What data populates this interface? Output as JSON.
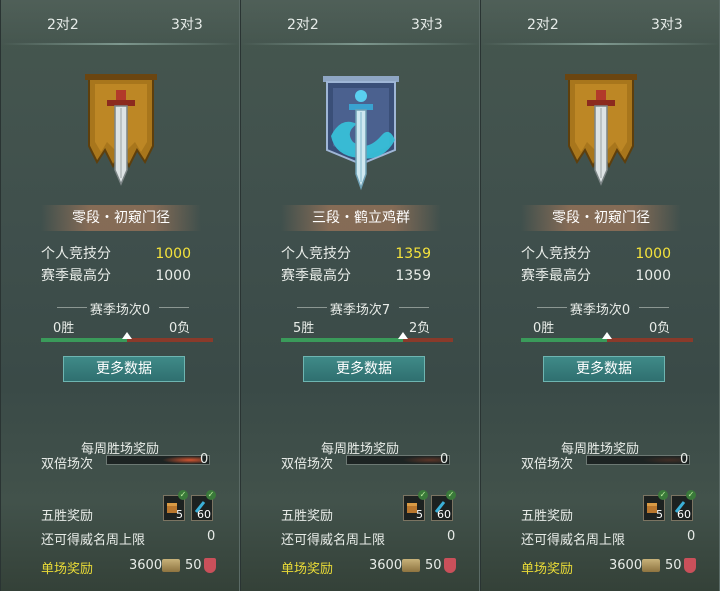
{
  "panels": [
    {
      "tabs": {
        "left": "2对2",
        "right": "3对3"
      },
      "emblem": "bronze-sword-banner-icon",
      "rank": "零段・初窥门径",
      "score": {
        "label": "个人竞技分",
        "value": "1000"
      },
      "high": {
        "label": "赛季最高分",
        "value": "1000"
      },
      "season": {
        "title": "赛季场次0",
        "wins": "0胜",
        "losses": "0负",
        "progress": 0.5
      },
      "more_button": "更多数据",
      "weekly": {
        "title": "每周胜场奖励",
        "double_label": "双倍场次",
        "double_value": "0"
      },
      "five_win": {
        "label": "五胜奖励",
        "item_a_count": "5",
        "item_b_count": "60"
      },
      "limit": {
        "label": "还可得威名周上限",
        "value": "0"
      },
      "single": {
        "label": "单场奖励",
        "coins": "3600",
        "honor": "50"
      }
    },
    {
      "tabs": {
        "left": "2对2",
        "right": "3对3"
      },
      "emblem": "dragon-sword-banner-icon",
      "rank": "三段・鹤立鸡群",
      "score": {
        "label": "个人竞技分",
        "value": "1359"
      },
      "high": {
        "label": "赛季最高分",
        "value": "1359"
      },
      "season": {
        "title": "赛季场次7",
        "wins": "5胜",
        "losses": "2负",
        "progress": 0.71
      },
      "more_button": "更多数据",
      "weekly": {
        "title": "每周胜场奖励",
        "double_label": "双倍场次",
        "double_value": "0"
      },
      "five_win": {
        "label": "五胜奖励",
        "item_a_count": "5",
        "item_b_count": "60"
      },
      "limit": {
        "label": "还可得威名周上限",
        "value": "0"
      },
      "single": {
        "label": "单场奖励",
        "coins": "3600",
        "honor": "50"
      }
    },
    {
      "tabs": {
        "left": "2对2",
        "right": "3对3"
      },
      "emblem": "bronze-sword-banner-icon",
      "rank": "零段・初窥门径",
      "score": {
        "label": "个人竞技分",
        "value": "1000"
      },
      "high": {
        "label": "赛季最高分",
        "value": "1000"
      },
      "season": {
        "title": "赛季场次0",
        "wins": "0胜",
        "losses": "0负",
        "progress": 0.5
      },
      "more_button": "更多数据",
      "weekly": {
        "title": "每周胜场奖励",
        "double_label": "双倍场次",
        "double_value": "0"
      },
      "five_win": {
        "label": "五胜奖励",
        "item_a_count": "5",
        "item_b_count": "60"
      },
      "limit": {
        "label": "还可得威名周上限",
        "value": "0"
      },
      "single": {
        "label": "单场奖励",
        "coins": "3600",
        "honor": "50"
      }
    }
  ],
  "colors": {
    "score_highlight": "#f4e23c",
    "single_reward_label": "#e9db37",
    "button": "#2f6f70",
    "win_bar": "#3a9a5a",
    "loss_bar": "#8a3a2a"
  }
}
